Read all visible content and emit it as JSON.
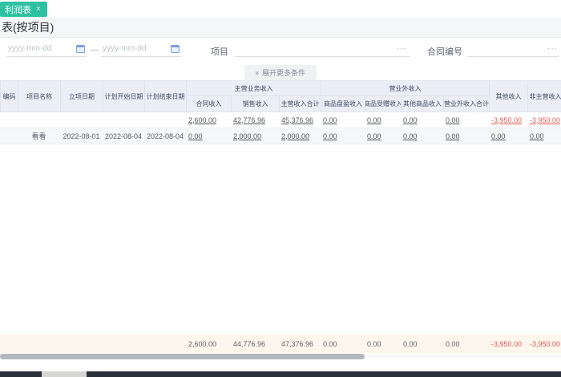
{
  "tab": {
    "label": "利润表",
    "close_icon": "×"
  },
  "page": {
    "title": "表(按项目)"
  },
  "filters": {
    "date_start_placeholder": "yyyy-mm-dd",
    "date_end_placeholder": "yyyy-mm-dd",
    "date_separator": "—",
    "project_label": "项目",
    "contract_label": "合同编号",
    "ellipsis": "···",
    "expand_icon": "»",
    "expand_label": "展开更多条件"
  },
  "table": {
    "columns": [
      {
        "label": "编码",
        "group": null,
        "align": "center"
      },
      {
        "label": "项目名称",
        "group": null,
        "align": "center"
      },
      {
        "label": "立项日期",
        "group": null,
        "align": "center"
      },
      {
        "label": "计划开始日期",
        "group": null,
        "align": "center"
      },
      {
        "label": "计划结束日期",
        "group": null,
        "align": "center"
      },
      {
        "label": "合同收入",
        "group": "主营业务收入",
        "align": "num"
      },
      {
        "label": "销售收入",
        "group": "主营业务收入",
        "align": "num"
      },
      {
        "label": "主营收入合计",
        "group": "主营业务收入",
        "align": "num"
      },
      {
        "label": "商品盘盈收入",
        "group": "营业外收入",
        "align": "num"
      },
      {
        "label": "商品受赠收入",
        "group": "营业外收入",
        "align": "num"
      },
      {
        "label": "其他商品收入",
        "group": "营业外收入",
        "align": "num"
      },
      {
        "label": "营业外收入合计",
        "group": "营业外收入",
        "align": "num"
      },
      {
        "label": "其他收入",
        "group": null,
        "align": "num"
      },
      {
        "label": "非主营收入合计",
        "group": null,
        "align": "num"
      }
    ],
    "rows": [
      [
        "",
        "",
        "",
        "",
        "",
        "2,600.00",
        "42,776.96",
        "45,376.96",
        "0.00",
        "0.00",
        "0.00",
        "0.00",
        "-3,950.00",
        "-3,950.00"
      ],
      [
        "",
        "看看",
        "2022-08-01",
        "2022-08-04",
        "2022-08-04",
        "0.00",
        "2,000.00",
        "2,000.00",
        "0.00",
        "0.00",
        "0.00",
        "0.00",
        "0.00",
        "0.00"
      ]
    ],
    "summary": [
      "",
      "",
      "",
      "",
      "",
      "2,600.00",
      "44,776.96",
      "47,376.96",
      "0.00",
      "0.00",
      "0.00",
      "0.00",
      "-3,950.00",
      "-3,950.00"
    ]
  },
  "colors": {
    "tab_green": "#2dc1a2",
    "negative_red": "#e25a55",
    "summary_bg": "#fdf6ec",
    "header_bg": "#ebeef6"
  }
}
